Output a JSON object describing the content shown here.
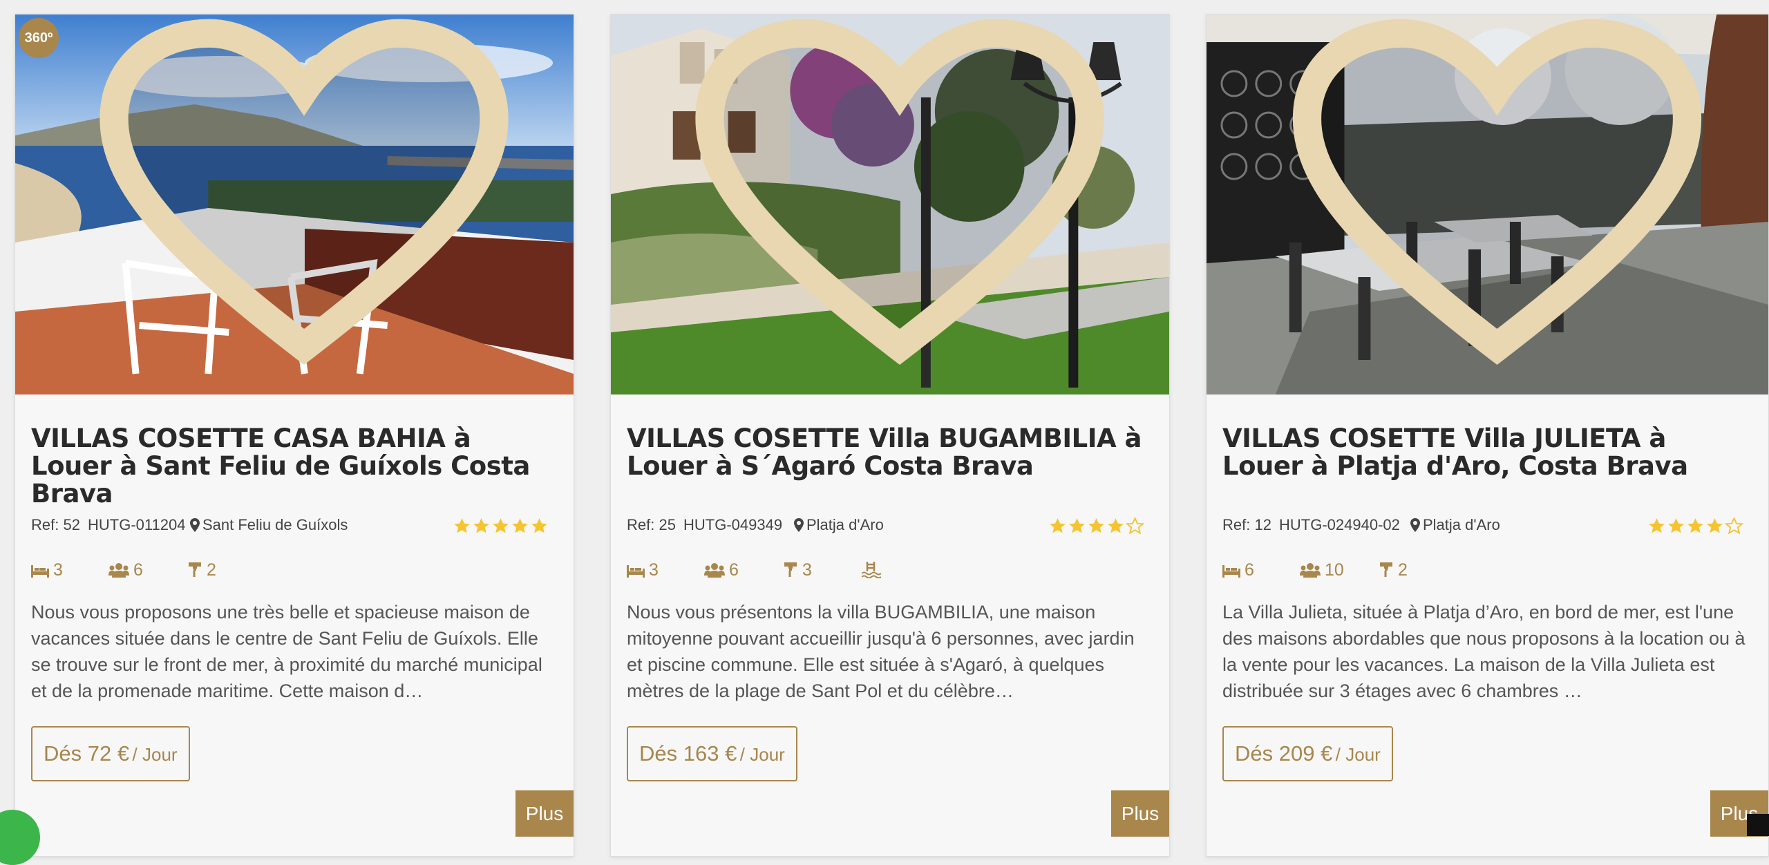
{
  "colors": {
    "accent": "#a8864c",
    "star": "#f5c430",
    "background": "#efefef"
  },
  "listings": [
    {
      "badge": "360º",
      "title": "VILLAS COSETTE CASA BAHIA à Louer à Sant Feliu de Guíxols Costa Brava",
      "ref": "Ref: 52",
      "hutg": "HUTG-011204",
      "location": "Sant Feliu de Guíxols",
      "rating": 5,
      "bedrooms": "3",
      "guests": "6",
      "showers": "2",
      "description": "Nous vous proposons une très belle et spacieuse maison de vacances située dans le centre de Sant Feliu de Guíxols. Elle se trouve sur le front de mer, à proximité du marché municipal et de la promenade maritime. Cette maison d…",
      "price": "Dés 72 €",
      "price_unit": "/ Jour",
      "more_label": "Plus"
    },
    {
      "title": "VILLAS COSETTE Villa BUGAMBILIA à Louer à S´Agaró Costa Brava",
      "ref": "Ref: 25",
      "hutg": "HUTG-049349",
      "location": "Platja d'Aro",
      "rating": 4,
      "bedrooms": "3",
      "guests": "6",
      "showers": "3",
      "pool": true,
      "description": "Nous vous présentons la villa BUGAMBILIA, une maison mitoyenne pouvant accueillir jusqu'à 6 personnes, avec jardin et piscine commune. Elle est située à s'Agaró, à quelques mètres de la plage de Sant Pol et du célèbre…",
      "price": "Dés 163 €",
      "price_unit": "/ Jour",
      "more_label": "Plus"
    },
    {
      "title": "VILLAS COSETTE Villa JULIETA à Louer à Platja d'Aro, Costa Brava",
      "ref": "Ref: 12",
      "hutg": "HUTG-024940-02",
      "location": "Platja d'Aro",
      "rating": 4,
      "bedrooms": "6",
      "guests": "10",
      "showers": "2",
      "description": "La Villa Julieta, située à Platja d’Aro, en bord de mer, est l'une des maisons abordables que nous proposons à la location ou à la vente pour les vacances. La maison de la Villa Julieta est distribuée sur 3 étages avec 6 chambres …",
      "price": "Dés 209 €",
      "price_unit": "/ Jour",
      "more_label": "Plus"
    }
  ]
}
